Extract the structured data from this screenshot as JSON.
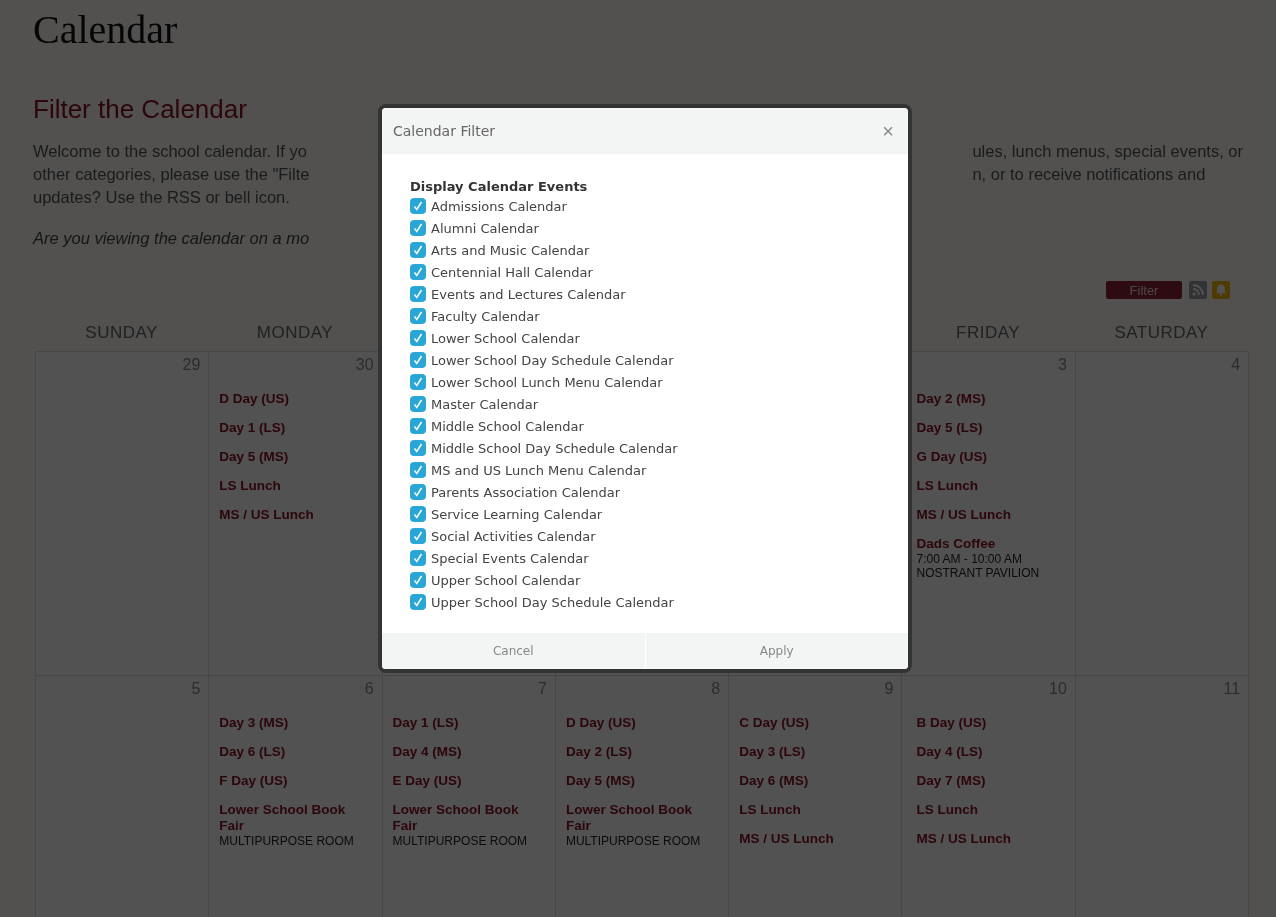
{
  "page_title": "Calendar",
  "filter_heading": "Filter the Calendar",
  "intro_left_lines": [
    "Welcome to the school calendar. If yo",
    "other categories, please use the \"Filte",
    "updates? Use the RSS or bell icon."
  ],
  "intro_right_lines": [
    "ules, lunch menus, special events, or",
    "n, or to receive notifications and"
  ],
  "mobile_note": "Are you viewing the calendar on a mo",
  "toolbar": {
    "filter_button": "Filter"
  },
  "weekdays": [
    "SUNDAY",
    "MONDAY"
  ],
  "weekdays_after_gap": [
    "FRIDAY",
    "SATURDAY"
  ],
  "weeks": [
    {
      "days": [
        {
          "number": "29"
        },
        {
          "number": "30",
          "events": [
            {
              "title": "D Day (US)"
            },
            {
              "title": "Day 1 (LS)"
            },
            {
              "title": "Day 5 (MS)"
            },
            {
              "title": "LS Lunch"
            },
            {
              "title": "MS / US Lunch"
            }
          ]
        }
      ],
      "days_after_gap": [
        {
          "number": "3",
          "events": [
            {
              "title": "Day 2 (MS)"
            },
            {
              "title": "Day 5 (LS)"
            },
            {
              "title": "G Day (US)"
            },
            {
              "title": "LS Lunch"
            },
            {
              "title": "MS / US Lunch"
            },
            {
              "title": "Dads Coffee",
              "details": [
                "7:00 AM - 10:00 AM",
                "NOSTRANT PAVILION"
              ]
            }
          ]
        },
        {
          "number": "4"
        }
      ]
    },
    {
      "days": [
        {
          "number": "5"
        },
        {
          "number": "6",
          "events": [
            {
              "title": "Day 3 (MS)"
            },
            {
              "title": "Day 6 (LS)"
            },
            {
              "title": "F Day (US)"
            },
            {
              "title": "Lower School Book Fair",
              "details": [
                "MULTIPURPOSE ROOM"
              ]
            }
          ]
        },
        {
          "number": "7",
          "events": [
            {
              "title": "Day 1 (LS)"
            },
            {
              "title": "Day 4 (MS)"
            },
            {
              "title": "E Day (US)"
            },
            {
              "title": "Lower School Book Fair",
              "details": [
                "MULTIPURPOSE ROOM"
              ]
            }
          ]
        },
        {
          "number": "8",
          "events": [
            {
              "title": "D Day (US)"
            },
            {
              "title": "Day 2 (LS)"
            },
            {
              "title": "Day 5 (MS)"
            },
            {
              "title": "Lower School Book Fair",
              "details": [
                "MULTIPURPOSE ROOM"
              ]
            }
          ]
        },
        {
          "number": "9",
          "events": [
            {
              "title": "C Day (US)"
            },
            {
              "title": "Day 3 (LS)"
            },
            {
              "title": "Day 6 (MS)"
            },
            {
              "title": "LS Lunch"
            },
            {
              "title": "MS / US Lunch"
            }
          ]
        },
        {
          "number": "10",
          "events": [
            {
              "title": "B Day (US)"
            },
            {
              "title": "Day 4 (LS)"
            },
            {
              "title": "Day 7 (MS)"
            },
            {
              "title": "LS Lunch"
            },
            {
              "title": "MS / US Lunch"
            }
          ]
        },
        {
          "number": "11"
        }
      ]
    }
  ],
  "modal": {
    "title": "Calendar Filter",
    "close": "×",
    "section_label": "Display Calendar Events",
    "options": [
      {
        "label": "Admissions Calendar",
        "checked": true
      },
      {
        "label": "Alumni Calendar",
        "checked": true
      },
      {
        "label": "Arts and Music Calendar",
        "checked": true
      },
      {
        "label": "Centennial Hall Calendar",
        "checked": true
      },
      {
        "label": "Events and Lectures Calendar",
        "checked": true
      },
      {
        "label": "Faculty Calendar",
        "checked": true
      },
      {
        "label": "Lower School Calendar",
        "checked": true
      },
      {
        "label": "Lower School Day Schedule Calendar",
        "checked": true
      },
      {
        "label": "Lower School Lunch Menu Calendar",
        "checked": true
      },
      {
        "label": "Master Calendar",
        "checked": true
      },
      {
        "label": "Middle School Calendar",
        "checked": true
      },
      {
        "label": "Middle School Day Schedule Calendar",
        "checked": true
      },
      {
        "label": "MS and US Lunch Menu Calendar",
        "checked": true
      },
      {
        "label": "Parents Association Calendar",
        "checked": true
      },
      {
        "label": "Service Learning Calendar",
        "checked": true
      },
      {
        "label": "Social Activities Calendar",
        "checked": true
      },
      {
        "label": "Special Events Calendar",
        "checked": true
      },
      {
        "label": "Upper School Calendar",
        "checked": true
      },
      {
        "label": "Upper School Day Schedule Calendar",
        "checked": true
      }
    ],
    "buttons": [
      "Cancel",
      "Apply"
    ]
  }
}
